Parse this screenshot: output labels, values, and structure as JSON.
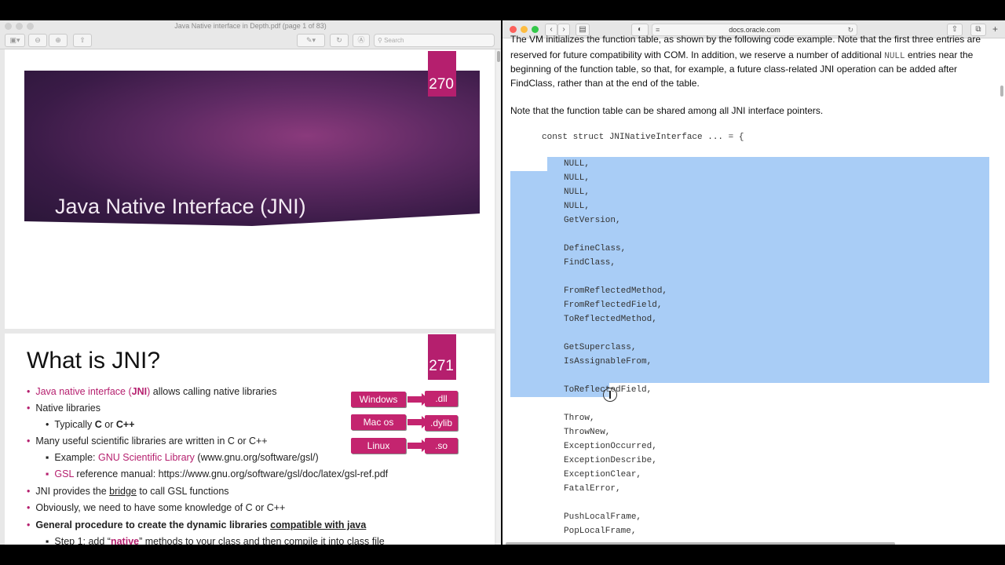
{
  "pdf": {
    "window_title": "Java Native interface in Depth.pdf (page 1 of 83)",
    "search_placeholder": "Search",
    "slide1": {
      "page_number": "270",
      "title": "Java Native Interface (JNI)"
    },
    "slide2": {
      "page_number": "271",
      "title": "What is JNI?",
      "bullets": {
        "b1_link": "Java native interface (",
        "b1_bold": "JNI",
        "b1_link_end": ")",
        "b1_rest": " allows calling native libraries",
        "b2": "Native libraries",
        "b3_pre": "Typically ",
        "b3_c": "C",
        "b3_or": " or ",
        "b3_cpp": "C++",
        "b4": "Many useful scientific libraries are written in C or C++",
        "b5_pre": "Example: ",
        "b5_link": "GNU Scientific Library",
        "b5_rest": " (www.gnu.org/software/gsl/)",
        "b6_link": "GSL",
        "b6_rest": " reference manual: https://www.gnu.org/software/gsl/doc/latex/gsl-ref.pdf",
        "b7_pre": "JNI provides the ",
        "b7_u": "bridge",
        "b7_rest": " to call GSL functions",
        "b8": "Obviously, we need to have some knowledge of C or C++",
        "b9_pre": "General procedure to create the dynamic libraries ",
        "b9_u": "compatible with java",
        "b10_pre": "Step 1: add “",
        "b10_native": "native",
        "b10_rest": "” methods to your class and then compile it into class file"
      },
      "diagram": [
        {
          "os": "Windows",
          "ext": ".dll"
        },
        {
          "os": "Mac os",
          "ext": ".dylib"
        },
        {
          "os": "Linux",
          "ext": ".so"
        }
      ]
    }
  },
  "safari": {
    "url": "docs.oracle.com",
    "para1_l1": "The VM initializes the function table, as shown by the following code example. Note that the first three entries are",
    "para1_l2_pre": "reserved for future compatibility with COM. In addition, we reserve a number of additional ",
    "para1_l2_code": "NULL",
    "para1_l2_post": " entries near the",
    "para1_l3": "beginning of the function table, so that, for example, a future class-related JNI operation can be added after",
    "para1_l4": "FindClass, rather than at the end of the table.",
    "para2": "Note that the function table can be shared among all JNI interface pointers.",
    "code_header": "const struct JNINativeInterface ... = {",
    "code_lines": [
      "NULL,",
      "NULL,",
      "NULL,",
      "NULL,",
      "GetVersion,",
      "",
      "DefineClass,",
      "FindClass,",
      "",
      "FromReflectedMethod,",
      "FromReflectedField,",
      "ToReflectedMethod,",
      "",
      "GetSuperclass,",
      "IsAssignableFrom,",
      "",
      "ToReflectedField,",
      "",
      "Throw,",
      "ThrowNew,",
      "ExceptionOccurred,",
      "ExceptionDescribe,",
      "ExceptionClear,",
      "FatalError,",
      "",
      "PushLocalFrame,",
      "PopLocalFrame,"
    ]
  }
}
